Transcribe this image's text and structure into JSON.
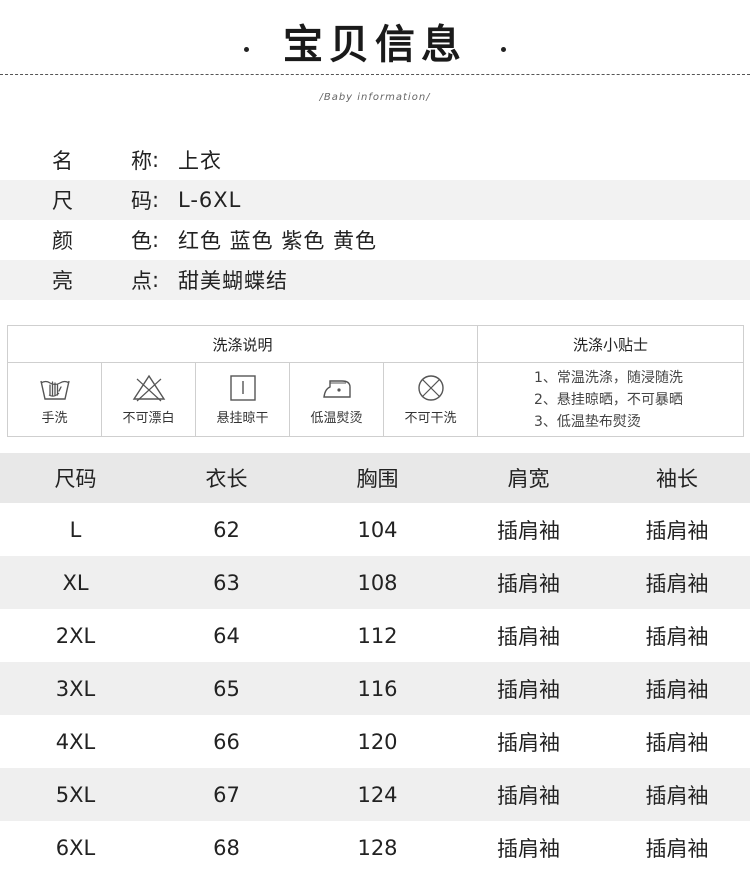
{
  "header": {
    "title": "宝贝信息",
    "subtitle": "/Baby information/"
  },
  "info": [
    {
      "key_a": "名",
      "key_b": "称",
      "colon": ":",
      "value": "上衣"
    },
    {
      "key_a": "尺",
      "key_b": "码",
      "colon": ":",
      "value": "L-6XL"
    },
    {
      "key_a": "颜",
      "key_b": "色",
      "colon": ":",
      "value": "红色 蓝色 紫色 黄色"
    },
    {
      "key_a": "亮",
      "key_b": "点",
      "colon": ":",
      "value": "甜美蝴蝶结"
    }
  ],
  "wash": {
    "left_title": "洗涤说明",
    "right_title": "洗涤小贴士",
    "icons": [
      {
        "icon": "hand-wash-icon",
        "label": "手洗"
      },
      {
        "icon": "no-bleach-icon",
        "label": "不可漂白"
      },
      {
        "icon": "hang-dry-icon",
        "label": "悬挂晾干"
      },
      {
        "icon": "low-iron-icon",
        "label": "低温熨烫"
      },
      {
        "icon": "no-dry-clean-icon",
        "label": "不可干洗"
      }
    ],
    "tips": [
      "1、常温洗涤，随浸随洗",
      "2、悬挂晾晒，不可暴晒",
      "3、低温垫布熨烫"
    ]
  },
  "size_table": {
    "headers": [
      "尺码",
      "衣长",
      "胸围",
      "肩宽",
      "袖长"
    ],
    "rows": [
      [
        "L",
        "62",
        "104",
        "插肩袖",
        "插肩袖"
      ],
      [
        "XL",
        "63",
        "108",
        "插肩袖",
        "插肩袖"
      ],
      [
        "2XL",
        "64",
        "112",
        "插肩袖",
        "插肩袖"
      ],
      [
        "3XL",
        "65",
        "116",
        "插肩袖",
        "插肩袖"
      ],
      [
        "4XL",
        "66",
        "120",
        "插肩袖",
        "插肩袖"
      ],
      [
        "5XL",
        "67",
        "124",
        "插肩袖",
        "插肩袖"
      ],
      [
        "6XL",
        "68",
        "128",
        "插肩袖",
        "插肩袖"
      ]
    ]
  }
}
